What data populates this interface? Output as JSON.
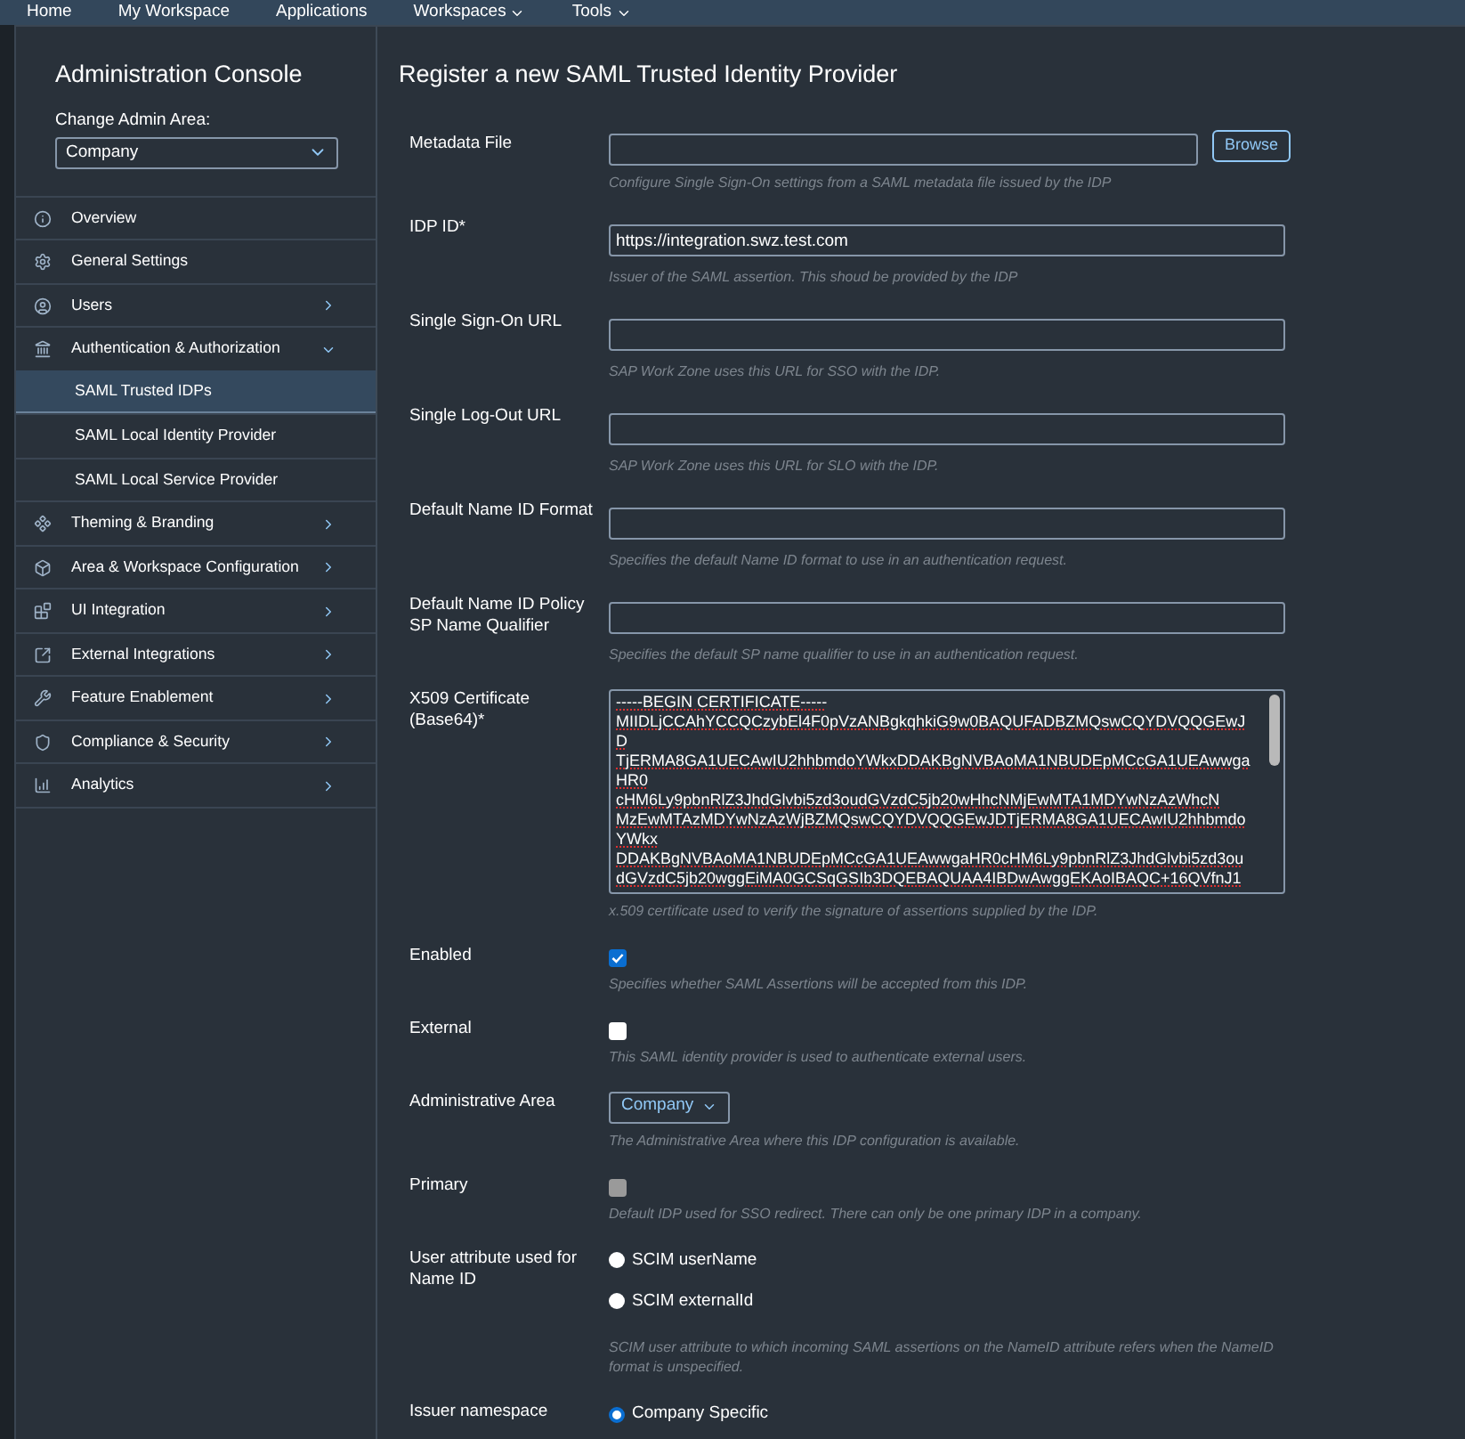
{
  "top_nav": [
    {
      "label": "Home",
      "kind": "link"
    },
    {
      "label": "My Workspace",
      "kind": "link"
    },
    {
      "label": "Applications",
      "kind": "link"
    },
    {
      "label": "Workspaces",
      "kind": "menu"
    },
    {
      "label": "Tools",
      "kind": "menu"
    }
  ],
  "sidebar": {
    "title": "Administration Console",
    "area_label": "Change Admin Area:",
    "area_value": "Company",
    "items": [
      {
        "label": "Overview",
        "kind": "plain"
      },
      {
        "label": "General Settings",
        "kind": "plain"
      },
      {
        "label": "Users",
        "kind": "group",
        "expanded": false
      },
      {
        "label": "Authentication & Authorization",
        "kind": "group",
        "expanded": true,
        "children": [
          {
            "label": "SAML Trusted IDPs",
            "selected": true
          },
          {
            "label": "SAML Local Identity Provider",
            "selected": false
          },
          {
            "label": "SAML Local Service Provider",
            "selected": false
          }
        ]
      },
      {
        "label": "Theming & Branding",
        "kind": "group",
        "expanded": false
      },
      {
        "label": "Area & Workspace Configuration",
        "kind": "group",
        "expanded": false
      },
      {
        "label": "UI Integration",
        "kind": "group",
        "expanded": false
      },
      {
        "label": "External Integrations",
        "kind": "group",
        "expanded": false
      },
      {
        "label": "Feature Enablement",
        "kind": "group",
        "expanded": false
      },
      {
        "label": "Compliance & Security",
        "kind": "group",
        "expanded": false
      },
      {
        "label": "Analytics",
        "kind": "group",
        "expanded": false
      }
    ]
  },
  "form": {
    "title": "Register a new SAML Trusted Identity Provider",
    "fields": [
      {
        "kind": "file",
        "label": "Metadata File",
        "button": "Browse",
        "hint": "Configure Single Sign-On settings from a SAML metadata file issued by the IDP"
      },
      {
        "kind": "text",
        "label": "IDP ID*",
        "value": "https://integration.swz.test.com",
        "hint": "Issuer of the SAML assertion. This shoud be provided by the IDP"
      },
      {
        "kind": "text",
        "label": "Single Sign-On URL",
        "hint": "SAP Work Zone uses this URL for SSO with the IDP."
      },
      {
        "kind": "text",
        "label": "Single Log-Out URL",
        "hint": "SAP Work Zone uses this URL for SLO with the IDP."
      },
      {
        "kind": "text",
        "label": "Default Name ID Format",
        "hint": "Specifies the default Name ID format to use in an authentication request."
      },
      {
        "kind": "text",
        "label": "Default Name ID Policy SP Name Qualifier",
        "hint": "Specifies the default SP name qualifier to use in an authentication request."
      },
      {
        "kind": "certificate",
        "label": "X509 Certificate (Base64)*",
        "lines": [
          "-----BEGIN CERTIFICATE-----",
          "MIIDLjCCAhYCCQCzybEl4F0pVzANBgkqhkiG9w0BAQUFADBZMQswCQYDVQQGEwJ",
          "D",
          "TjERMA8GA1UECAwIU2hhbmdoYWkxDDAKBgNVBAoMA1NBUDEpMCcGA1UEAwwga",
          "HR0",
          "cHM6Ly9pbnRlZ3JhdGlvbi5zd3oudGVzdC5jb20wHhcNMjEwMTA1MDYwNzAzWhcN",
          "MzEwMTAzMDYwNzAzWjBZMQswCQYDVQQGEwJDTjERMA8GA1UECAwIU2hhbmdo",
          "YWkx",
          "DDAKBgNVBAoMA1NBUDEpMCcGA1UEAwwgaHR0cHM6Ly9pbnRlZ3JhdGlvbi5zd3ou",
          "dGVzdC5jb20wggEiMA0GCSqGSIb3DQEBAQUAA4IBDwAwggEKAoIBAQC+16QVfnJ1"
        ],
        "hint": "x.509 certificate used to verify the signature of assertions supplied by the IDP."
      },
      {
        "kind": "checkbox",
        "label": "Enabled",
        "checked": true,
        "disabled": false,
        "hint": "Specifies whether SAML Assertions will be accepted from this IDP."
      },
      {
        "kind": "checkbox",
        "label": "External",
        "checked": false,
        "disabled": false,
        "hint": "This SAML identity provider is used to authenticate external users."
      },
      {
        "kind": "select",
        "label": "Administrative Area",
        "value": "Company",
        "hint": "The Administrative Area where this IDP configuration is available."
      },
      {
        "kind": "checkbox",
        "label": "Primary",
        "checked": false,
        "disabled": true,
        "hint": "Default IDP used for SSO redirect. There can only be one primary IDP in a company."
      },
      {
        "kind": "radio",
        "label": "User attribute used for Name ID",
        "options": [
          {
            "label": "SCIM userName",
            "selected": false
          },
          {
            "label": "SCIM externalId",
            "selected": false
          }
        ],
        "hint": "SCIM user attribute to which incoming SAML assertions on the NameID attribute refers when the NameID format is unspecified."
      },
      {
        "kind": "radio",
        "label": "Issuer namespace",
        "options": [
          {
            "label": "Company Specific",
            "selected": true
          }
        ]
      }
    ]
  }
}
